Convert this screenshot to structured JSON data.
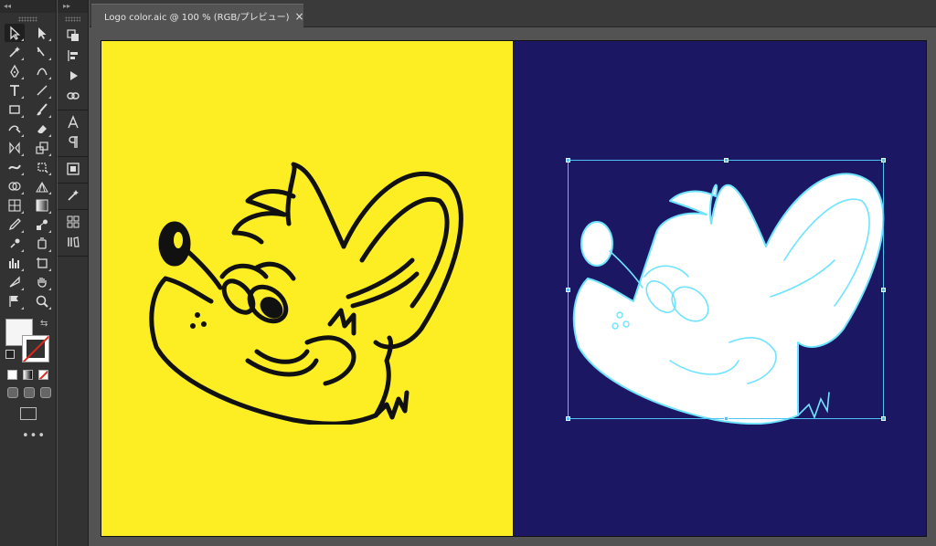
{
  "app": {
    "panel_left_collapse": "◂◂",
    "panel_right_expand": "▸▸"
  },
  "document_tab": {
    "title": "Logo color.aic @ 100 % (RGB/プレビュー)",
    "close_glyph": "×"
  },
  "tools": [
    {
      "name": "selection-tool",
      "glyph": "arrow",
      "active": true
    },
    {
      "name": "direct-selection-tool",
      "glyph": "arrow-solid"
    },
    {
      "name": "magic-wand-tool",
      "glyph": "wand"
    },
    {
      "name": "lasso-tool",
      "glyph": "lasso"
    },
    {
      "name": "pen-tool",
      "glyph": "pen"
    },
    {
      "name": "curvature-tool",
      "glyph": "curvature"
    },
    {
      "name": "type-tool",
      "glyph": "T"
    },
    {
      "name": "line-tool",
      "glyph": "line"
    },
    {
      "name": "rectangle-tool",
      "glyph": "rect"
    },
    {
      "name": "paintbrush-tool",
      "glyph": "brush"
    },
    {
      "name": "shaper-tool",
      "glyph": "shaper"
    },
    {
      "name": "eraser-tool",
      "glyph": "eraser"
    },
    {
      "name": "rotate-tool",
      "glyph": "rotate"
    },
    {
      "name": "scale-tool",
      "glyph": "scale"
    },
    {
      "name": "width-tool",
      "glyph": "width"
    },
    {
      "name": "free-transform-tool",
      "glyph": "free-transform"
    },
    {
      "name": "shape-builder-tool",
      "glyph": "shape-builder"
    },
    {
      "name": "perspective-grid-tool",
      "glyph": "perspective"
    },
    {
      "name": "mesh-tool",
      "glyph": "mesh"
    },
    {
      "name": "gradient-tool",
      "glyph": "gradient"
    },
    {
      "name": "eyedropper-tool",
      "glyph": "eyedropper"
    },
    {
      "name": "blend-tool",
      "glyph": "blend"
    },
    {
      "name": "symbol-sprayer-tool",
      "glyph": "symbol"
    },
    {
      "name": "symbol-alt-tool",
      "glyph": "symbol-alt"
    },
    {
      "name": "column-graph-tool",
      "glyph": "graph"
    },
    {
      "name": "artboard-tool",
      "glyph": "artboard"
    },
    {
      "name": "slice-tool",
      "glyph": "slice"
    },
    {
      "name": "hand-tool",
      "glyph": "hand"
    },
    {
      "name": "flag-tool",
      "glyph": "flag"
    },
    {
      "name": "zoom-tool",
      "glyph": "zoom"
    }
  ],
  "color_controls": {
    "fill_color": "#f5f5f5",
    "stroke_color": "none",
    "swap_glyph": "⇆",
    "more_glyph": "•••"
  },
  "secondary_panel": [
    {
      "name": "transform-panel-icon",
      "glyph": "transform"
    },
    {
      "name": "align-panel-icon",
      "glyph": "align"
    },
    {
      "name": "actions-panel-icon",
      "glyph": "play"
    },
    {
      "name": "links-panel-icon",
      "glyph": "links"
    },
    {
      "name": "character-panel-icon",
      "glyph": "A"
    },
    {
      "name": "paragraph-panel-icon",
      "glyph": "¶"
    },
    {
      "name": "image-trace-panel-icon",
      "glyph": "trace"
    },
    {
      "name": "magic-wand-panel-icon",
      "glyph": "wand"
    },
    {
      "name": "artboards-panel-icon",
      "glyph": "artboards"
    },
    {
      "name": "libraries-panel-icon",
      "glyph": "libraries"
    }
  ],
  "colors": {
    "artboard_left": "#fcee23",
    "artboard_right": "#1b1763",
    "selection": "#4fc3f7"
  }
}
